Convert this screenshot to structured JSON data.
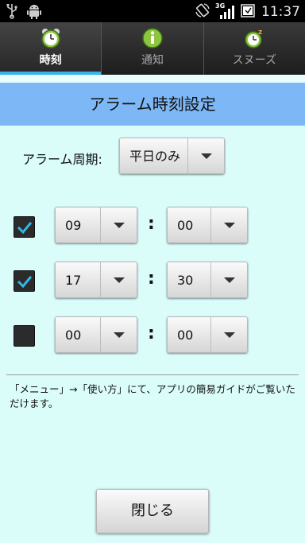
{
  "status_bar": {
    "time": "11:37",
    "network_type": "3G",
    "icons": [
      "usb-icon",
      "android-icon",
      "rotate-icon",
      "signal-icon",
      "battery-icon"
    ]
  },
  "tabs": [
    {
      "label": "時刻",
      "icon": "alarm-clock-icon",
      "active": true
    },
    {
      "label": "通知",
      "icon": "info-icon",
      "active": false
    },
    {
      "label": "スヌーズ",
      "icon": "snooze-clock-icon",
      "active": false
    }
  ],
  "header": {
    "title": "アラーム時刻設定"
  },
  "alarm_period": {
    "label": "アラーム周期:",
    "value": "平日のみ"
  },
  "alarms": [
    {
      "enabled": true,
      "hour": "09",
      "minute": "00",
      "separator": ":"
    },
    {
      "enabled": true,
      "hour": "17",
      "minute": "30",
      "separator": ":"
    },
    {
      "enabled": false,
      "hour": "00",
      "minute": "00",
      "separator": ":"
    }
  ],
  "note": "「メニュー」→「使い方」にて、アプリの簡易ガイドがご覧いただけます。",
  "close_button": {
    "label": "閉じる"
  },
  "colors": {
    "accent": "#37b3ea",
    "header_bg": "#7eb7f5",
    "page_bg": "#dafdfa",
    "check": "#33b5e5"
  }
}
